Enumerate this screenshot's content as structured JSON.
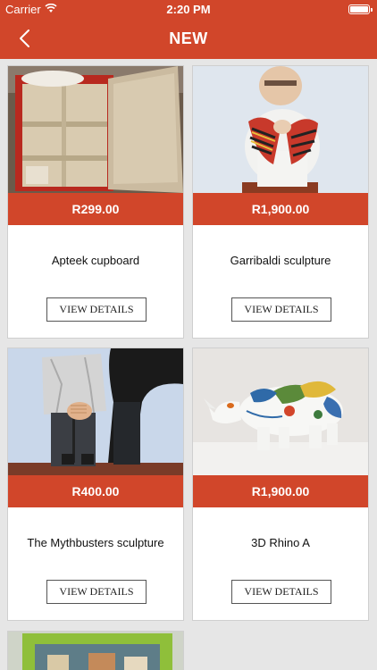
{
  "status_bar": {
    "carrier": "Carrier",
    "time": "2:20 PM"
  },
  "header": {
    "title": "NEW"
  },
  "products": [
    {
      "price": "R299.00",
      "name": "Apteek cupboard",
      "button": "VIEW DETAILS"
    },
    {
      "price": "R1,900.00",
      "name": "Garribaldi sculpture",
      "button": "VIEW DETAILS"
    },
    {
      "price": "R400.00",
      "name": "The Mythbusters sculpture",
      "button": "VIEW DETAILS"
    },
    {
      "price": "R1,900.00",
      "name": "3D Rhino A",
      "button": "VIEW DETAILS"
    }
  ],
  "colors": {
    "accent": "#d1462a",
    "background": "#e6e6e6"
  }
}
